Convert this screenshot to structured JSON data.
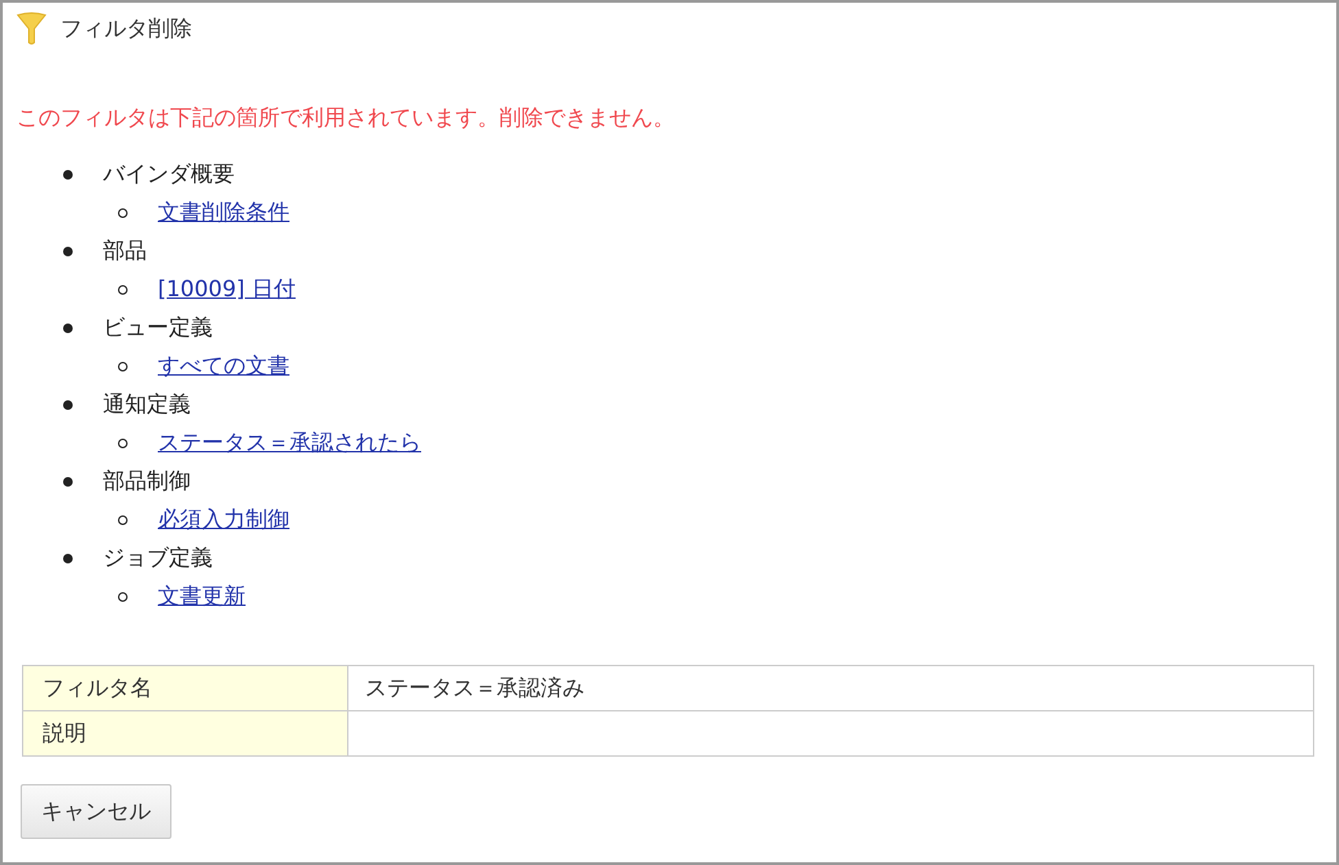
{
  "title": "フィルタ削除",
  "message": "このフィルタは下記の箇所で利用されています。削除できません。",
  "usages": [
    {
      "label": "バインダ概要",
      "children": [
        {
          "label": "文書削除条件"
        }
      ]
    },
    {
      "label": "部品",
      "children": [
        {
          "label": "[10009] 日付"
        }
      ]
    },
    {
      "label": "ビュー定義",
      "children": [
        {
          "label": "すべての文書"
        }
      ]
    },
    {
      "label": "通知定義",
      "children": [
        {
          "label": "ステータス＝承認されたら"
        }
      ]
    },
    {
      "label": "部品制御",
      "children": [
        {
          "label": "必須入力制御"
        }
      ]
    },
    {
      "label": "ジョブ定義",
      "children": [
        {
          "label": "文書更新"
        }
      ]
    }
  ],
  "table": {
    "rows": [
      {
        "label": "フィルタ名",
        "value": "ステータス＝承認済み"
      },
      {
        "label": "説明"
      }
    ]
  },
  "buttons": [
    "キャンセル"
  ]
}
